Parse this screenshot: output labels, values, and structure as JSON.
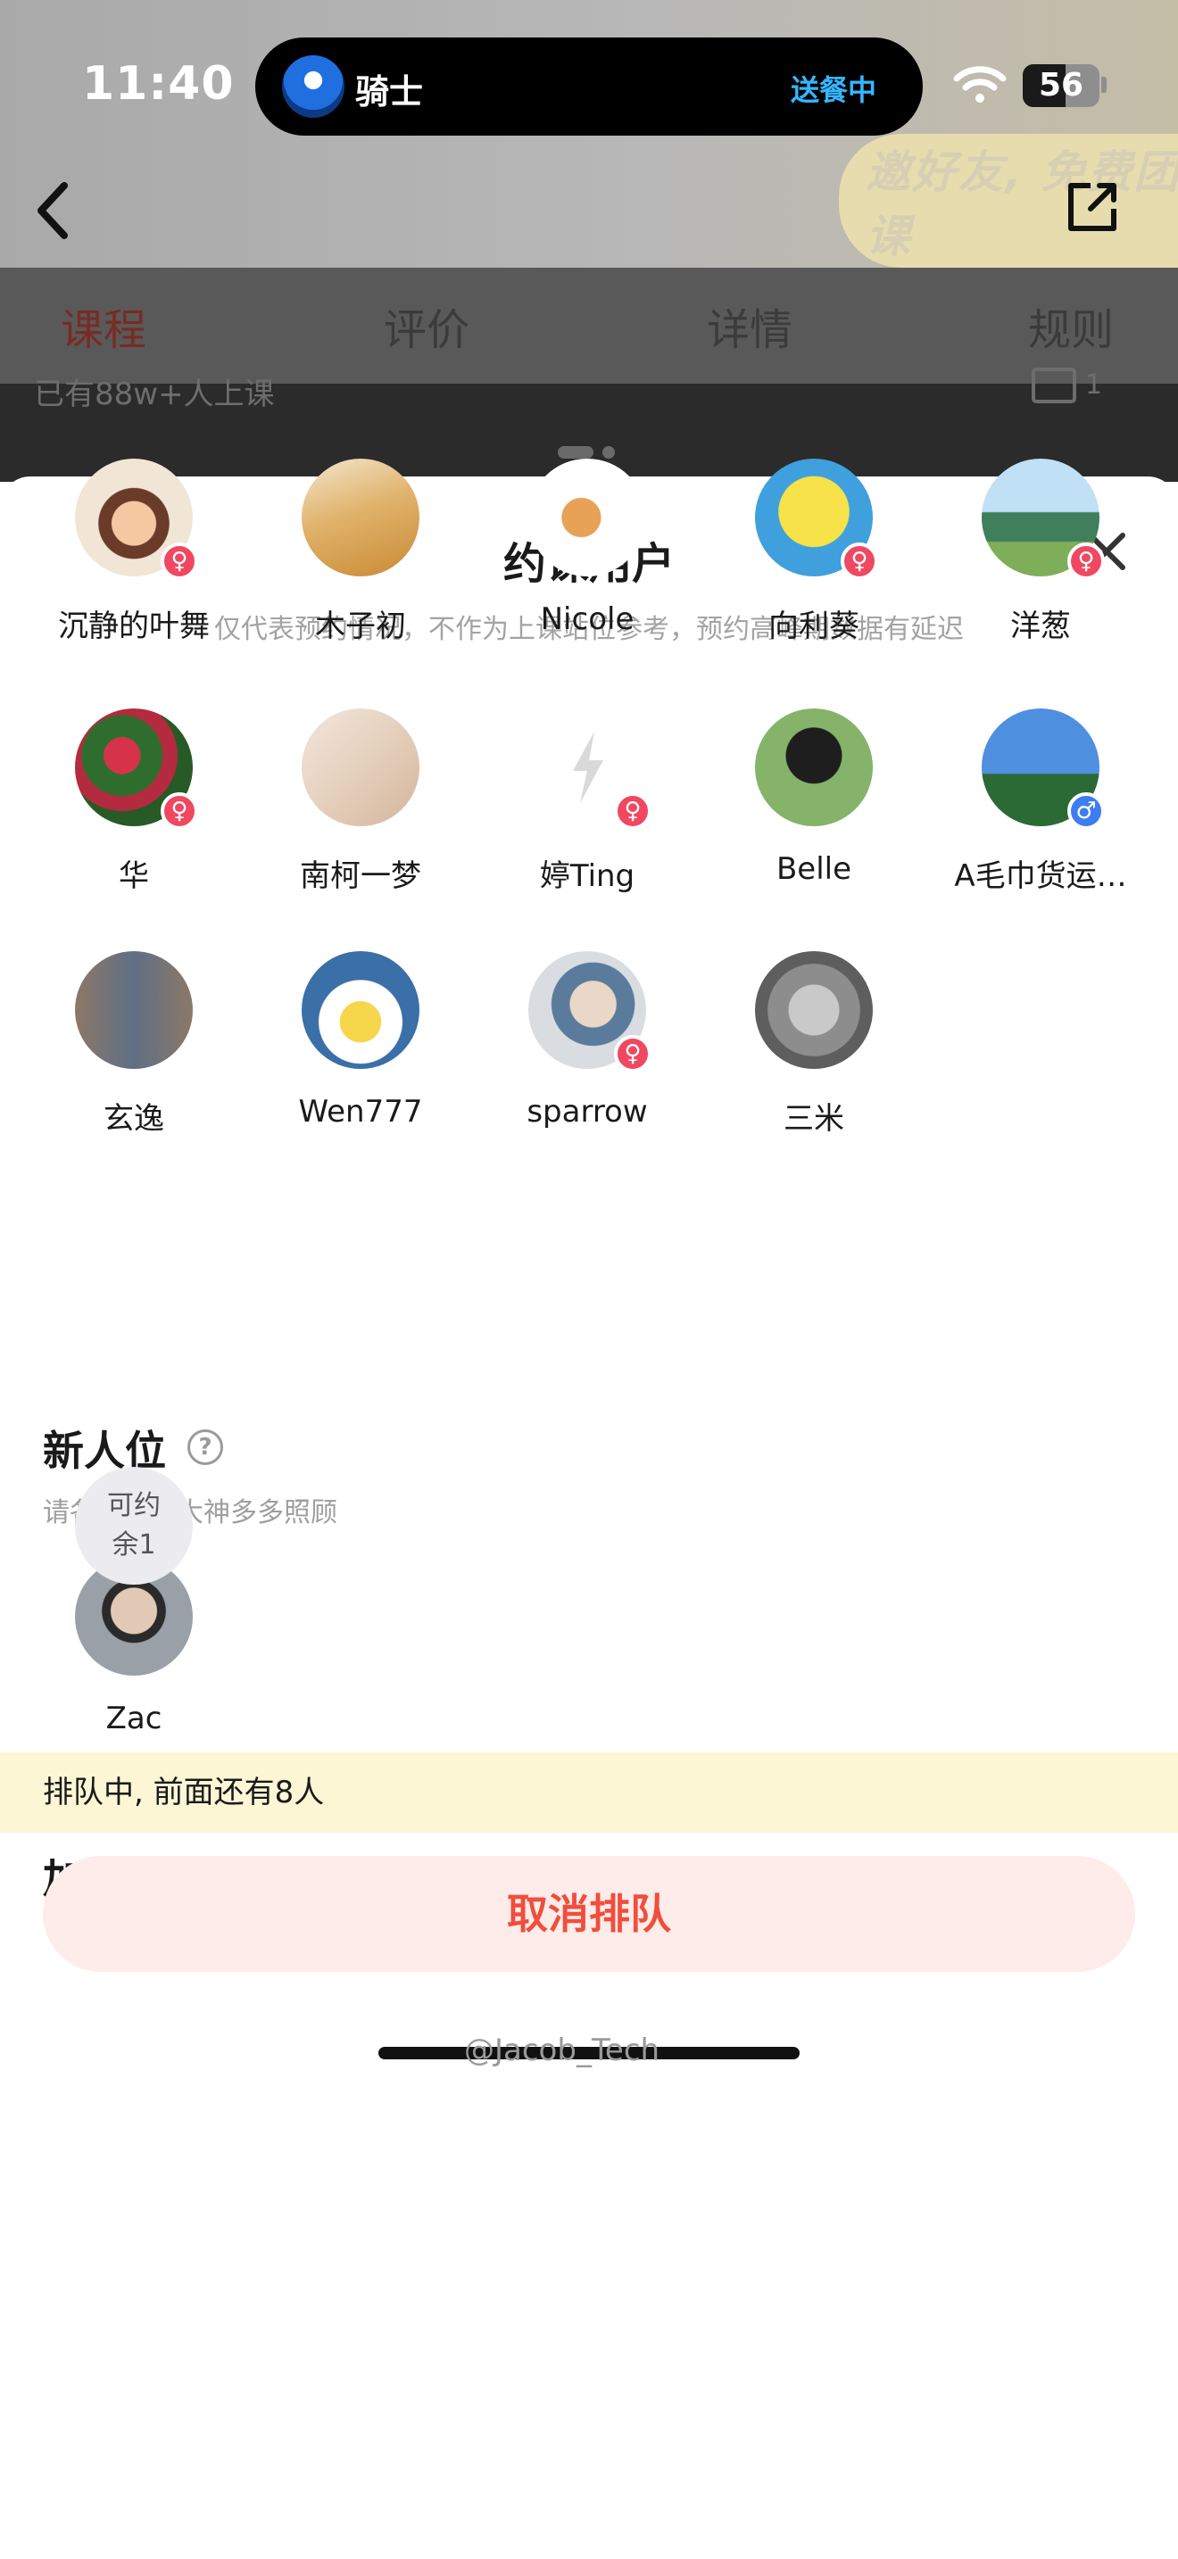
{
  "status_bar": {
    "time": "11:40",
    "island_label": "骑士",
    "island_status": "送餐中",
    "battery": "56",
    "battery_level": 0.56
  },
  "background": {
    "banner_text": "邀好友, 免费团课",
    "tabs": [
      "课程",
      "评价",
      "详情",
      "规则"
    ],
    "subtitle": "已有88w+人上课",
    "image_count": "1"
  },
  "sheet": {
    "title": "约课用户",
    "subtitle": "仅代表预约情况，不作为上课站位参考，预约高峰期数据有延迟",
    "users": [
      {
        "name": "沉静的叶舞",
        "gender": "female",
        "gender_symbol": "♀"
      },
      {
        "name": "木子初",
        "gender": "none",
        "gender_symbol": ""
      },
      {
        "name": "Nicole",
        "gender": "none",
        "gender_symbol": ""
      },
      {
        "name": "向利葵",
        "gender": "female",
        "gender_symbol": "♀"
      },
      {
        "name": "洋葱",
        "gender": "female",
        "gender_symbol": "♀"
      },
      {
        "name": "华",
        "gender": "female",
        "gender_symbol": "♀"
      },
      {
        "name": "南柯一梦",
        "gender": "none",
        "gender_symbol": ""
      },
      {
        "name": "婷Ting",
        "gender": "female",
        "gender_symbol": "♀"
      },
      {
        "name": "Belle",
        "gender": "none",
        "gender_symbol": ""
      },
      {
        "name": "A毛巾货运…",
        "gender": "male",
        "gender_symbol": "♂"
      },
      {
        "name": "玄逸",
        "gender": "none",
        "gender_symbol": ""
      },
      {
        "name": "Wen777",
        "gender": "none",
        "gender_symbol": ""
      },
      {
        "name": "sparrow",
        "gender": "female",
        "gender_symbol": "♀"
      },
      {
        "name": "三米",
        "gender": "none",
        "gender_symbol": ""
      }
    ],
    "newcomer": {
      "title": "新人位",
      "subtitle": "请各位团课大神多多照顾",
      "users": [
        {
          "name": "Zac"
        }
      ]
    },
    "extra_seat": {
      "title": "加座位",
      "seat_line1": "可约",
      "seat_line2": "余1"
    },
    "queue_status": "排队中, 前面还有8人",
    "cancel_label": "取消排队"
  },
  "watermark": "@Jacob_Tech"
}
